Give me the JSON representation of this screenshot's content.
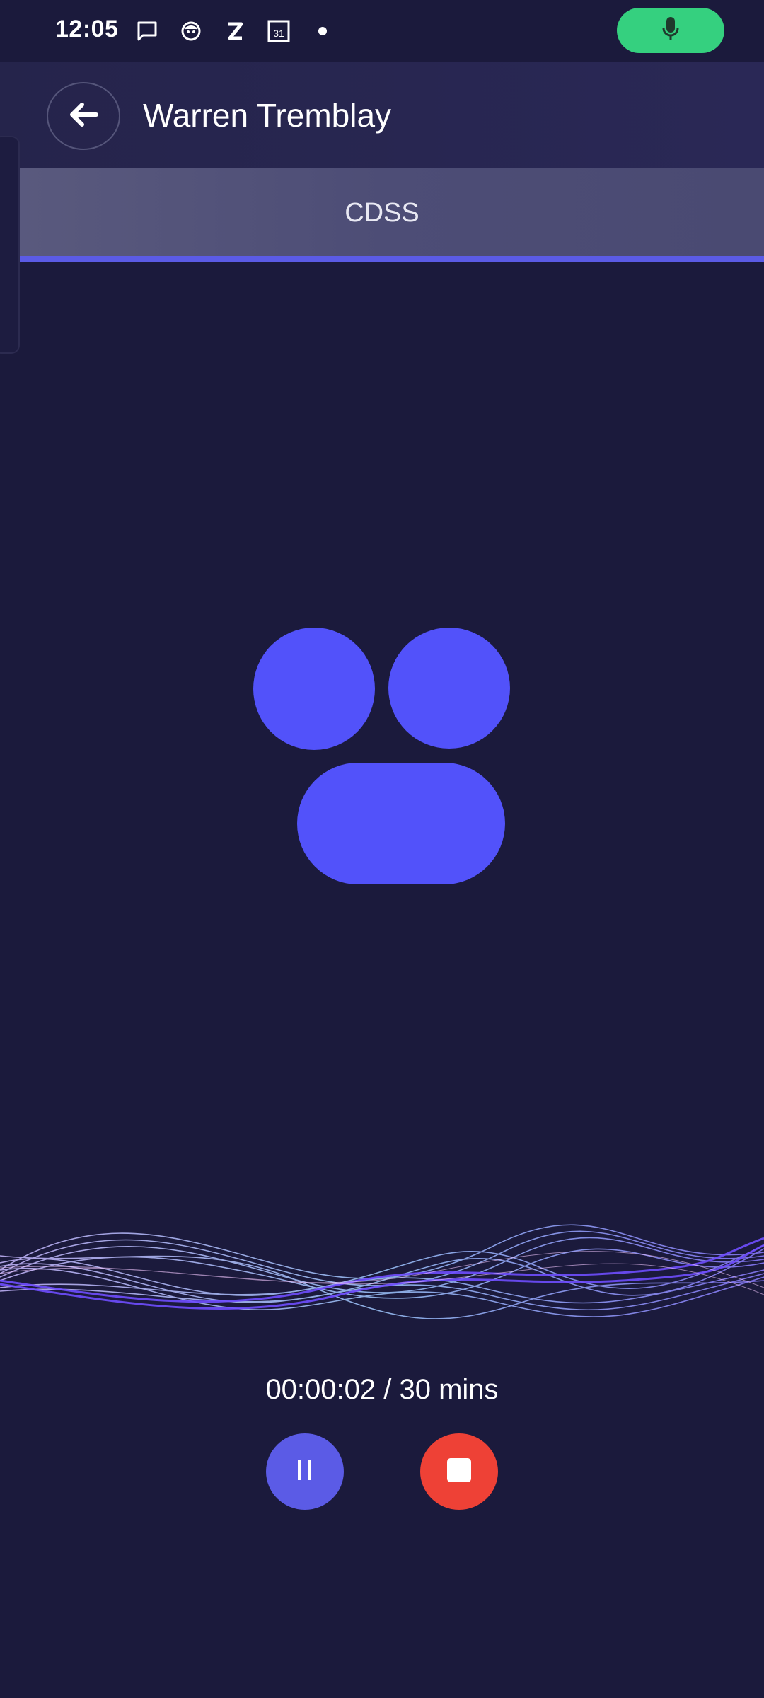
{
  "status_bar": {
    "time": "12:05",
    "calendar_day": "31",
    "icons": [
      "message-icon",
      "face-icon",
      "z-icon",
      "calendar-icon",
      "dot-icon"
    ],
    "mic_indicator_color": "#35d07f"
  },
  "header": {
    "title": "Warren Tremblay",
    "back_icon": "arrow-left-icon"
  },
  "tabs": [
    {
      "label": "CDSS",
      "selected": true
    }
  ],
  "recording": {
    "timer": "00:00:02 / 30 mins",
    "pause_icon": "pause-icon",
    "stop_icon": "stop-icon"
  },
  "colors": {
    "background": "#1b1a3c",
    "accent": "#5b5be6",
    "logo": "#5252fa",
    "stop": "#ee4136",
    "mic": "#35d07f"
  }
}
